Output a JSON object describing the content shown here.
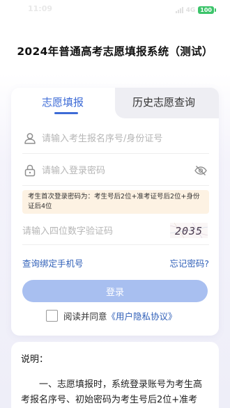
{
  "status_bar": {
    "time": "11:09",
    "network": "4G",
    "battery": "100"
  },
  "page": {
    "title": "2024年普通高考志愿填报系统（测试）"
  },
  "tabs": {
    "fill": "志愿填报",
    "history": "历史志愿查询"
  },
  "form": {
    "username_placeholder": "请输入考生报名序号/身份证号",
    "password_placeholder": "请输入登录密码",
    "hint": "考生首次登录密码为：考生号后2位+准考证号后2位+身份证后4位",
    "captcha_placeholder": "请输入四位数字验证码",
    "captcha_text": "2035",
    "bind_phone_link": "查询绑定手机号",
    "forgot_link": "忘记密码?",
    "login_button": "登录",
    "agree_text": "阅读并同意",
    "privacy_link": "《用户隐私协议》"
  },
  "notice": {
    "title": "说明：",
    "body": "一、志愿填报时，系统登录账号为考生高考报名序号、初始密码为考生号后2位+准考"
  },
  "colors": {
    "accent": "#3d6bd6",
    "link": "#2f5fb8",
    "button": "#a8bff0",
    "hint_bg": "#fdf2e3"
  },
  "icons": {
    "user": "user-icon",
    "lock": "lock-icon",
    "eye": "eye-off-icon"
  }
}
